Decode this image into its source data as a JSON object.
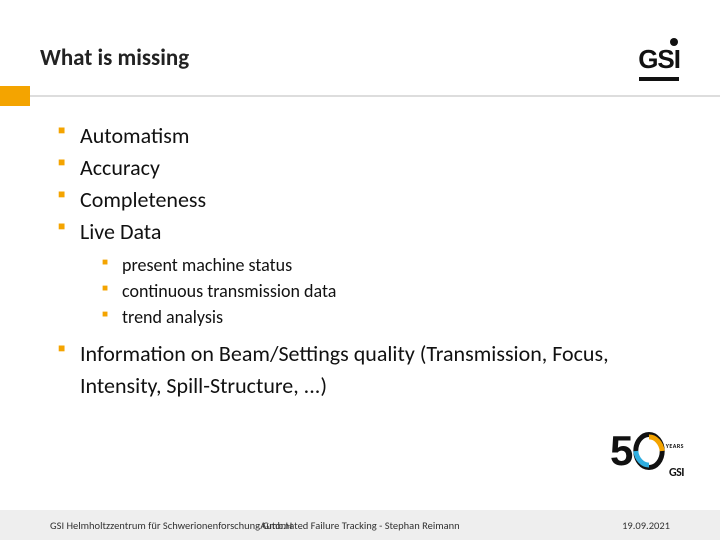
{
  "header": {
    "title": "What is missing",
    "logo_text": "GSI"
  },
  "bullets": {
    "items": [
      {
        "label": "Automatism"
      },
      {
        "label": "Accuracy"
      },
      {
        "label": "Completeness"
      },
      {
        "label": "Live Data"
      }
    ],
    "live_data_sub": [
      {
        "label": "present machine status"
      },
      {
        "label": "continuous transmission data"
      },
      {
        "label": "trend analysis"
      }
    ],
    "last": {
      "label": "Information on Beam/Settings quality (Transmission, Focus, Intensity, Spill-Structure, ...)"
    }
  },
  "anniversary": {
    "number": "50",
    "years_label": "YEARS",
    "org": "GSI"
  },
  "footer": {
    "org": "GSI Helmholtzzentrum für Schwerionenforschung Gmb.H",
    "talk": "Automated Failure Tracking - Stephan Reimann",
    "date": "19.09.2021"
  },
  "colors": {
    "accent": "#f4a400"
  }
}
